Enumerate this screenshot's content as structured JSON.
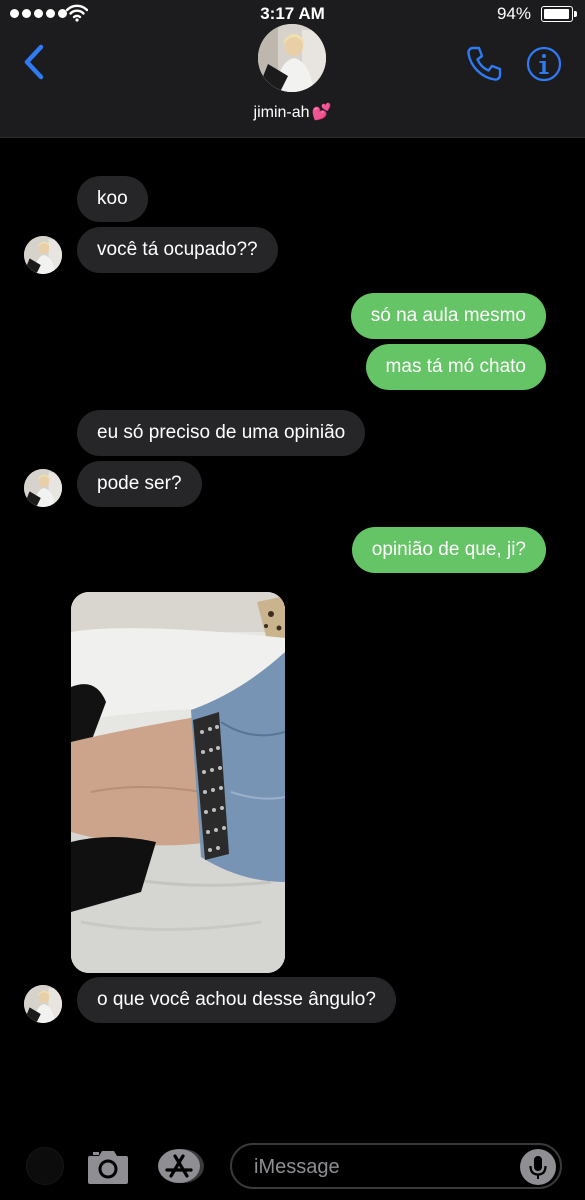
{
  "status_bar": {
    "time": "3:17 AM",
    "battery_percent": "94%",
    "signal_bars": 5,
    "battery_level": 0.94
  },
  "header": {
    "contact_name": "jimin-ah",
    "name_emoji": "💕",
    "icons": [
      "back-chevron-icon",
      "phone-icon",
      "info-icon"
    ]
  },
  "messages": [
    {
      "side": "in",
      "text": "koo"
    },
    {
      "side": "in",
      "text": "você tá ocupado??"
    },
    {
      "side": "out",
      "text": "só na aula mesmo"
    },
    {
      "side": "out",
      "text": "mas tá mó chato"
    },
    {
      "side": "in",
      "text": "eu só preciso de uma opinião"
    },
    {
      "side": "in",
      "text": "pode ser?"
    },
    {
      "side": "out",
      "text": "opinião de que, ji?"
    },
    {
      "side": "in",
      "type": "photo"
    },
    {
      "side": "in",
      "text": "o que você achou desse ângulo?"
    }
  ],
  "input_bar": {
    "placeholder": "iMessage",
    "icons": [
      "camera-icon",
      "app-store-icon",
      "microphone-icon"
    ]
  },
  "colors": {
    "outgoing_bubble": "#65c466",
    "incoming_bubble": "#262629",
    "accent": "#2f7bf6",
    "header_bg": "#1c1c1e"
  }
}
